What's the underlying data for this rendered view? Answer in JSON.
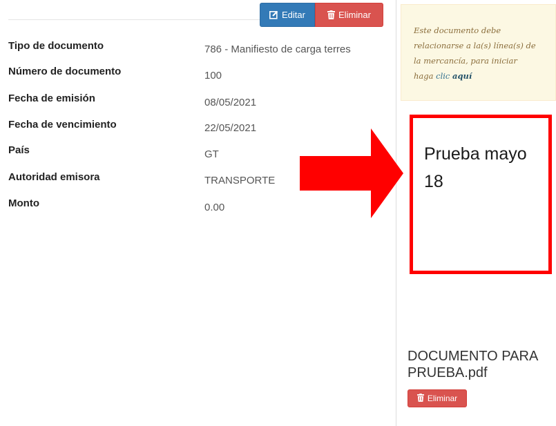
{
  "toolbar": {
    "edit_label": "Editar",
    "delete_label": "Eliminar"
  },
  "fields": [
    {
      "label": "Tipo de documento",
      "value": "786 - Manifiesto de carga terres"
    },
    {
      "label": "Número de documento",
      "value": "100"
    },
    {
      "label": "Fecha de emisión",
      "value": "08/05/2021"
    },
    {
      "label": "Fecha de vencimiento",
      "value": "22/05/2021"
    },
    {
      "label": "País",
      "value": "GT"
    },
    {
      "label": "Autoridad emisora",
      "value": "TRANSPORTE"
    },
    {
      "label": "Monto",
      "value": "0.00"
    }
  ],
  "alert": {
    "line1": "Este documento debe",
    "line2": "relacionarse a la(s) línea(s) de",
    "line3": "la mercancía, para iniciar",
    "line4_prefix": "haga",
    "link1": "clic",
    "link2": "aquí"
  },
  "annotation": {
    "note_line1": "Prueba mayo",
    "note_line2": "18"
  },
  "attachment": {
    "file_name_line1": "DOCUMENTO PARA",
    "file_name_line2": "PRUEBA.pdf",
    "delete_label": "Eliminar"
  },
  "colors": {
    "primary": "#337ab7",
    "danger": "#d9534f",
    "alert_bg": "#fcf8e3",
    "highlight": "#ff0000"
  }
}
